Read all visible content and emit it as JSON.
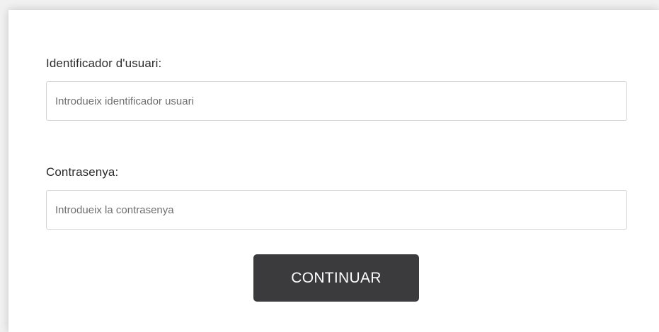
{
  "login_form": {
    "username": {
      "label": "Identificador d'usuari:",
      "placeholder": "Introdueix identificador usuari",
      "value": ""
    },
    "password": {
      "label": "Contrasenya:",
      "placeholder": "Introdueix la contrasenya",
      "value": ""
    },
    "submit_label": "CONTINUAR"
  },
  "colors": {
    "button_bg": "#3b3b3e",
    "button_text": "#ffffff",
    "page_bg": "#f1f1f1",
    "card_bg": "#ffffff",
    "border": "#d4d4d4"
  }
}
